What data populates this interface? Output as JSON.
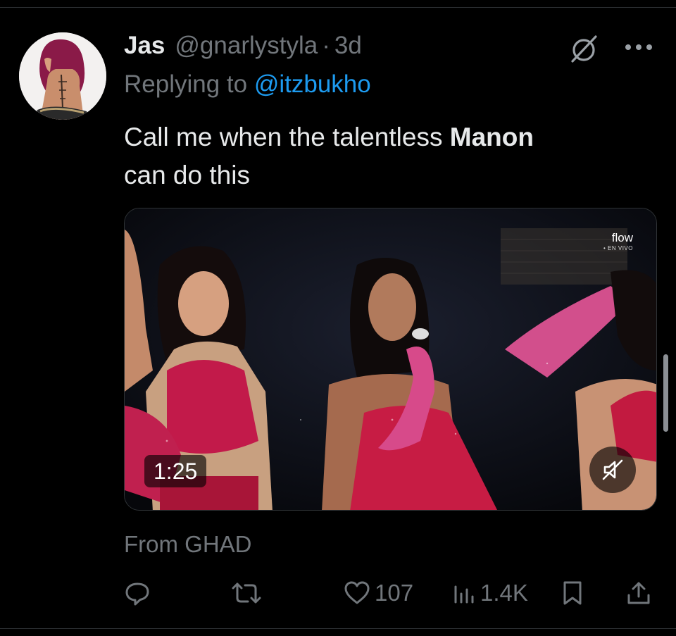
{
  "tweet": {
    "author_name": "Jas",
    "author_handle": "@gnarlystyla",
    "separator": "·",
    "time_ago": "3d",
    "reply_prefix": "Replying to",
    "reply_to": "@itzbukho",
    "text_before": "Call me when the talentless",
    "text_bold": "Manon",
    "text_after": "can do this",
    "source_label": "From GHAD"
  },
  "media": {
    "duration": "1:25",
    "watermark": "flow",
    "watermark_sub": "• EN VIVO",
    "muted": true
  },
  "actions": {
    "reply_count": "",
    "retweet_count": "",
    "like_count": "107",
    "views_count": "1.4K"
  },
  "icons": {
    "grok": "grok-icon",
    "more": "more-icon",
    "reply": "reply-icon",
    "retweet": "retweet-icon",
    "like": "heart-icon",
    "views": "views-icon",
    "bookmark": "bookmark-icon",
    "share": "share-icon",
    "mute": "muted-speaker-icon"
  },
  "colors": {
    "background": "#000000",
    "text_primary": "#e7e9ea",
    "text_secondary": "#71767b",
    "link": "#1d9bf0"
  }
}
